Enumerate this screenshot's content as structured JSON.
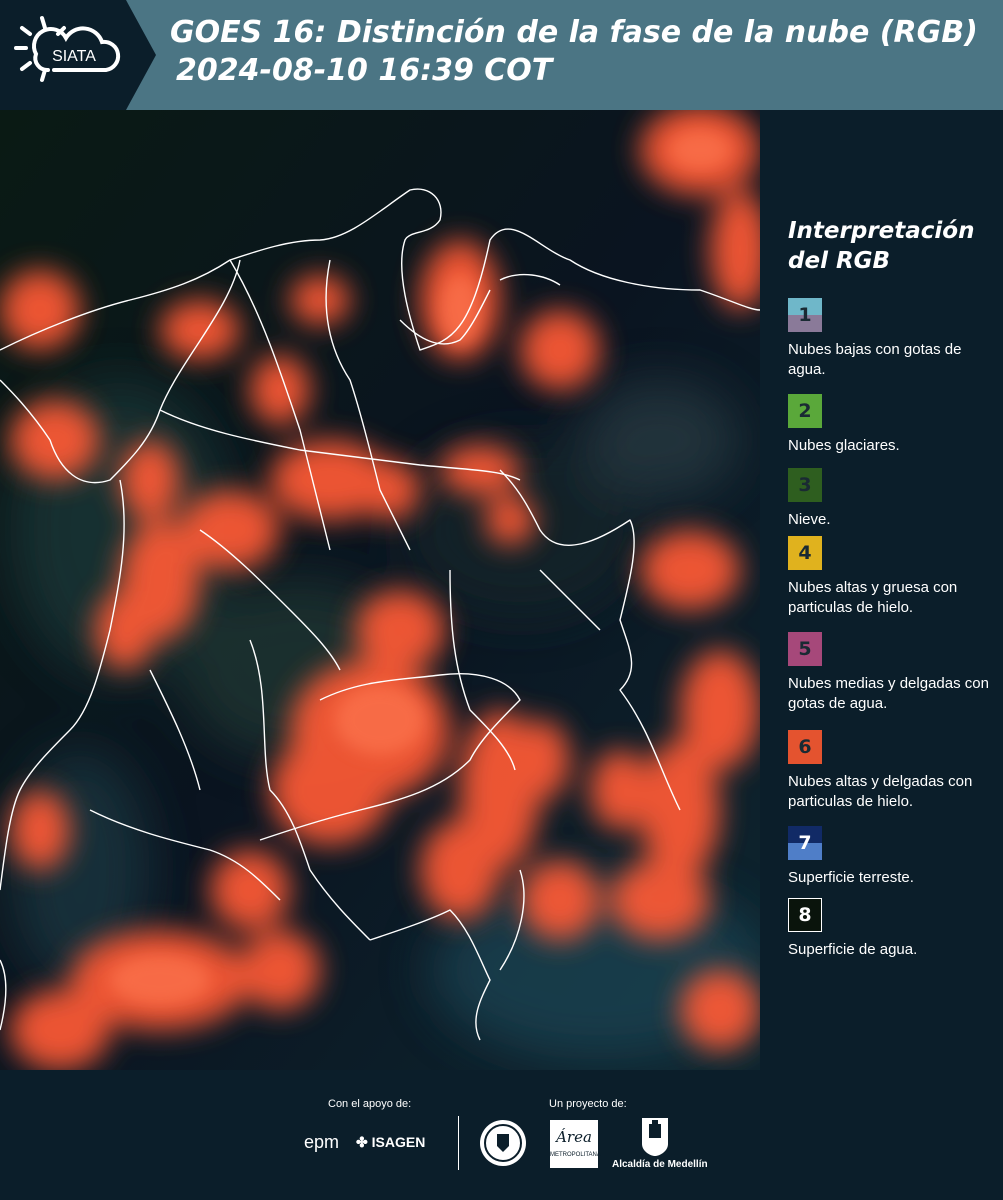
{
  "header": {
    "logo_text": "SIATA",
    "title_line1": "GOES 16: Distinción de la fase de la nube (RGB)",
    "title_line2": "2024-08-10 16:39 COT"
  },
  "legend": {
    "title_line1": "Interpretación",
    "title_line2": "del RGB",
    "items": [
      {
        "number": "1",
        "label": "Nubes bajas con gotas de agua.",
        "color_top": "#6fb7c9",
        "color_bottom": "#8a7a99"
      },
      {
        "number": "2",
        "label": "Nubes glaciares.",
        "color_top": "#5aa83a",
        "color_bottom": "#5aa83a"
      },
      {
        "number": "3",
        "label": "Nieve.",
        "color_top": "#2e5e1f",
        "color_bottom": "#2e5e1f"
      },
      {
        "number": "4",
        "label": "Nubes altas y gruesa con particulas de hielo.",
        "color_top": "#e0b21e",
        "color_bottom": "#e0b21e"
      },
      {
        "number": "5",
        "label": "Nubes medias y delgadas con gotas de agua.",
        "color_top": "#a6487a",
        "color_bottom": "#a6487a"
      },
      {
        "number": "6",
        "label": "Nubes altas y delgadas con particulas de hielo.",
        "color_top": "#e4532f",
        "color_bottom": "#e4532f"
      },
      {
        "number": "7",
        "label": "Superficie terreste.",
        "color_top": "#112a66",
        "color_bottom": "#4f7ec8"
      },
      {
        "number": "8",
        "label": "Superficie de agua.",
        "color_top": "#0a140c",
        "color_bottom": "#0a140c"
      }
    ]
  },
  "footer": {
    "support_label": "Con el apoyo de:",
    "project_label": "Un proyecto de:",
    "sponsor1": "epm",
    "sponsor2": "ISAGEN",
    "area_logo": "Área",
    "area_sub": "METROPOLITANA",
    "alcaldia": "Alcaldía de Medellín"
  },
  "colors": {
    "header_bg": "#4b7584",
    "panel_bg": "#0b1e2a",
    "cloud_ice": "#ff5a36"
  }
}
